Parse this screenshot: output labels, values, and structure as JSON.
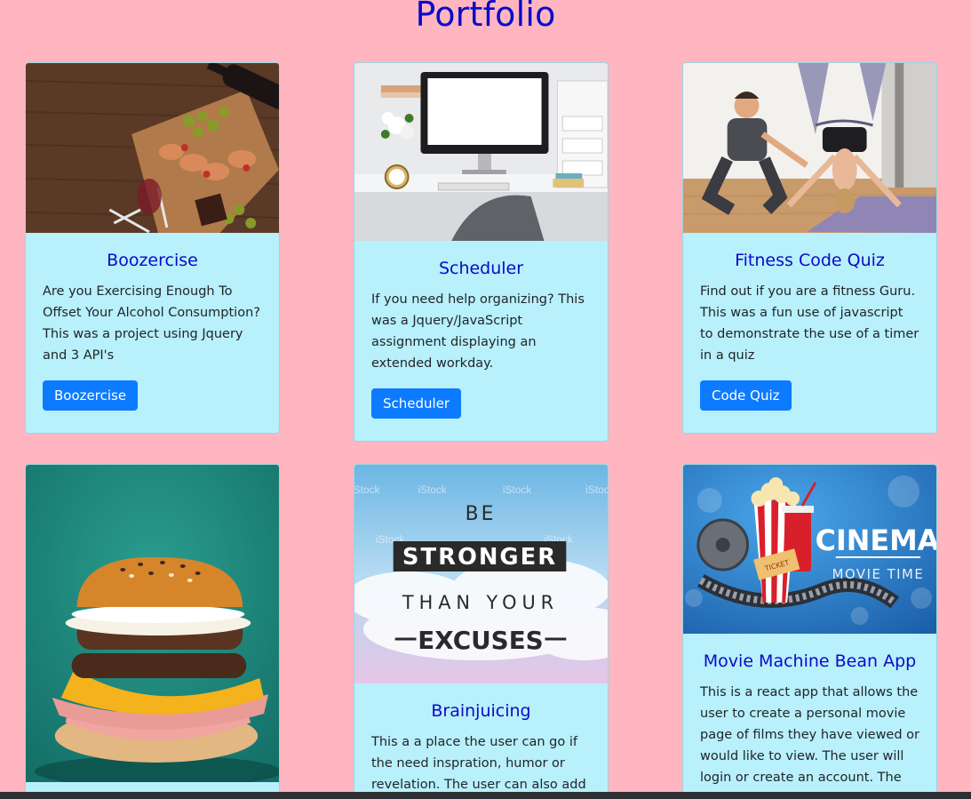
{
  "page": {
    "title": "Portfolio"
  },
  "cards": [
    {
      "title": "Boozercise",
      "text": "Are you Exercising Enough To Offset Your Alcohol Consumption? This was a project using Jquery and 3 API's",
      "button": "Boozercise",
      "image": "wine-and-charcuterie-image"
    },
    {
      "title": "Scheduler",
      "text": "If you need help organizing? This was a Jquery/JavaScript assignment displaying an extended workday.",
      "button": "Scheduler",
      "image": "desk-computer-image"
    },
    {
      "title": "Fitness Code Quiz",
      "text": "Find out if you are a fitness Guru. This was a fun use of javascript to demonstrate the use of a timer in a quiz",
      "button": "Code Quiz",
      "image": "aerial-yoga-image"
    },
    {
      "title": "",
      "text": "",
      "button": "",
      "image": "burger-image"
    },
    {
      "title": "Brainjuicing",
      "text": "This a a place the user can go if the need inspration, humor or revelation. The user can also add",
      "button": "",
      "image": "motivational-quote-image",
      "image_text": {
        "line1": "BE",
        "line2": "STRONGER",
        "line3": "THAN YOUR",
        "line4": "EXCUSES",
        "watermark": "iStock"
      }
    },
    {
      "title": "Movie Machine Bean App",
      "text": "This is a react app that allows the user to create a personal movie page of films they have viewed or would like to view. The user will login or create an account. The",
      "button": "",
      "image": "cinema-image",
      "image_text": {
        "brand": "CINEMA",
        "sub": "MOVIE TIME",
        "ticket": "TICKET"
      }
    }
  ],
  "colors": {
    "background": "#ffb6c1",
    "card": "#b8f0fb",
    "title": "#0a0ac8",
    "button": "#0d7bff"
  }
}
